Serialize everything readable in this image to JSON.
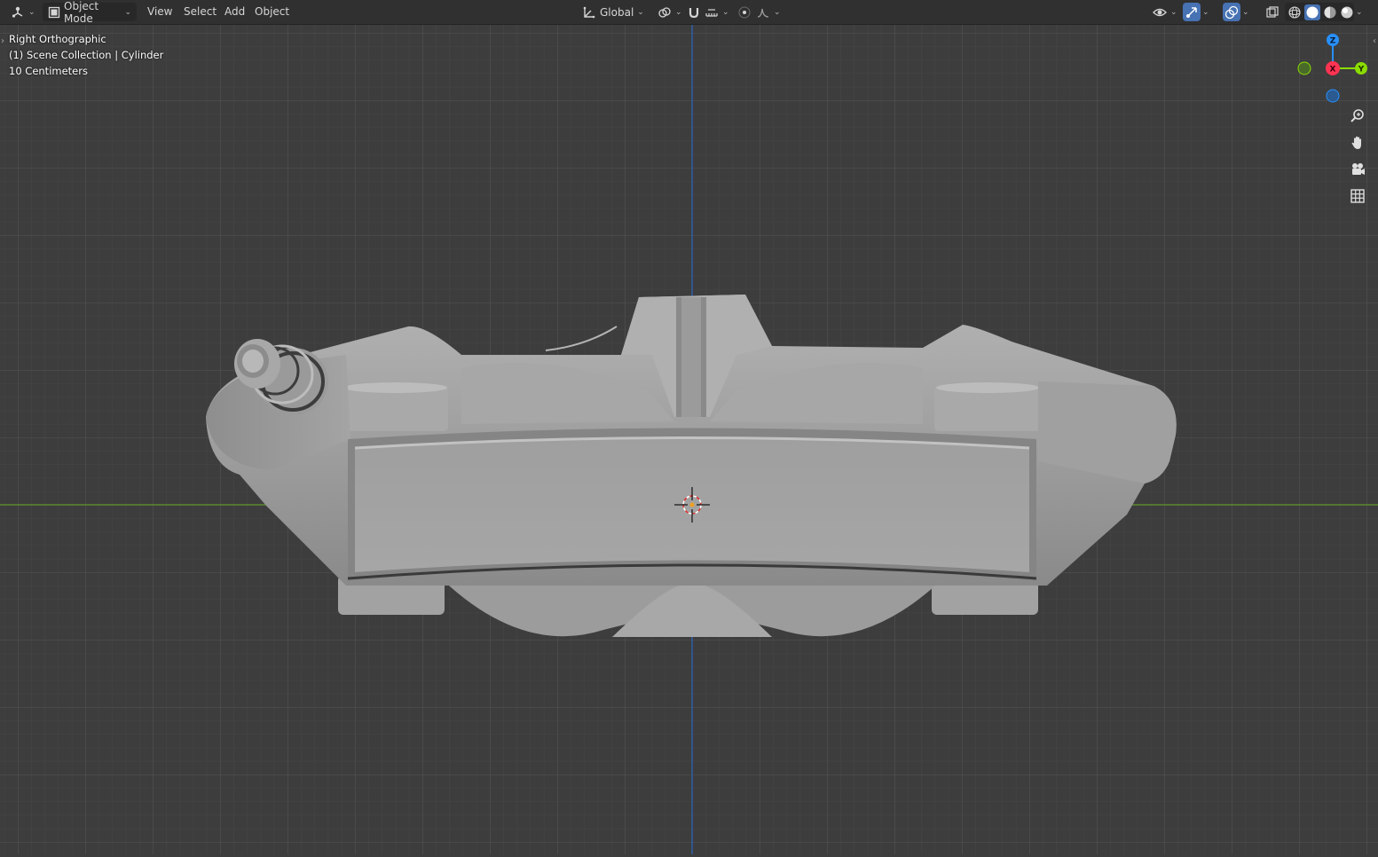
{
  "header": {
    "editor_type_icon": "3d-viewport-icon",
    "mode": {
      "label": "Object Mode",
      "icon": "object-mode-icon"
    },
    "menus": [
      "View",
      "Select",
      "Add",
      "Object"
    ],
    "transform_orientation": {
      "label": "Global",
      "icon": "transform-orientation-icon"
    },
    "pivot_icon": "pivot-point-icon",
    "snap_icon": "magnet-snap-icon",
    "snap_target_icon": "snap-increment-icon",
    "proportional_icon": "proportional-edit-icon",
    "falloff_icon": "falloff-curve-icon",
    "visibility_icon": "eye-visibility-icon",
    "gizmo_icon": "gizmo-toggle-icon",
    "overlay_icon": "overlay-toggle-icon",
    "xray_icon": "xray-toggle-icon",
    "shading_modes": [
      "wireframe",
      "solid",
      "material-preview",
      "rendered"
    ],
    "active_shading": "solid"
  },
  "viewport": {
    "view_name": "Right Orthographic",
    "collection_info": "(1) Scene Collection | Cylinder",
    "grid_scale": "10 Centimeters"
  },
  "navigation_gizmo": {
    "axes": {
      "z": "Z",
      "x": "X",
      "y": "Y"
    },
    "colors": {
      "x": "#ff3352",
      "y": "#8bdc00",
      "z": "#2890ff"
    }
  },
  "nav_buttons": [
    "zoom-icon",
    "pan-hand-icon",
    "camera-icon",
    "grid-view-icon"
  ],
  "colors": {
    "background": "#3d3d3d",
    "header": "#303030",
    "accent": "#4772b3",
    "axis_z_line": "#2f5fa6",
    "axis_y_line": "#5c8a2e"
  }
}
